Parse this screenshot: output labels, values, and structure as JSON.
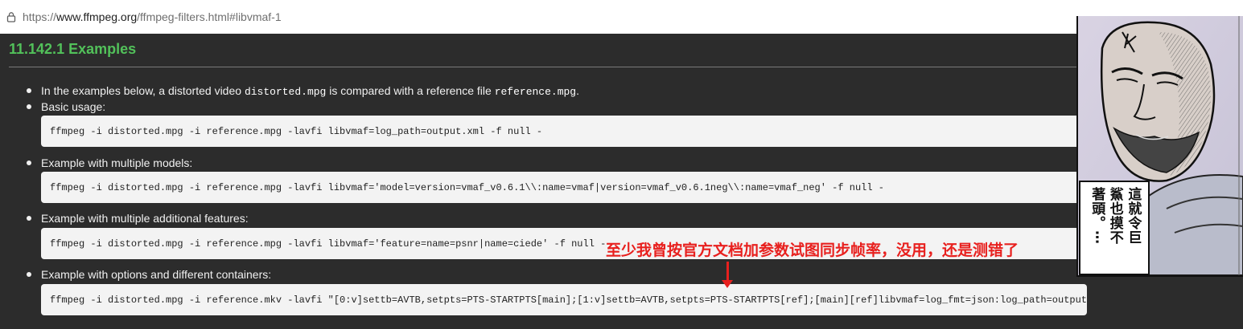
{
  "browser": {
    "url_prefix": "https://",
    "url_domain": "www.ffmpeg.org",
    "url_path": "/ffmpeg-filters.html#libvmaf-1"
  },
  "section": {
    "title": "11.142.1 Examples"
  },
  "items": [
    {
      "intro_pre": "In the examples below, a distorted video ",
      "code_a": "distorted.mpg",
      "intro_mid": " is compared with a reference file ",
      "code_b": "reference.mpg",
      "intro_post": "."
    },
    {
      "label": "Basic usage:",
      "code": "ffmpeg -i distorted.mpg -i reference.mpg -lavfi libvmaf=log_path=output.xml -f null -"
    },
    {
      "label": "Example with multiple models:",
      "code": "ffmpeg -i distorted.mpg -i reference.mpg -lavfi libvmaf='model=version=vmaf_v0.6.1\\\\:name=vmaf|version=vmaf_v0.6.1neg\\\\:name=vmaf_neg' -f null -"
    },
    {
      "label": "Example with multiple additional features:",
      "code": "ffmpeg -i distorted.mpg -i reference.mpg -lavfi libvmaf='feature=name=psnr|name=ciede' -f null -"
    },
    {
      "label": "Example with options and different containers:",
      "code": "ffmpeg -i distorted.mpg -i reference.mkv -lavfi \"[0:v]settb=AVTB,setpts=PTS-STARTPTS[main];[1:v]settb=AVTB,setpts=PTS-STARTPTS[ref];[main][ref]libvmaf=log_fmt=json:log_path=output.json\" -f null -"
    }
  ],
  "annotation": {
    "text": "至少我曾按官方文档加参数试图同步帧率，没用，还是测错了",
    "color": "#e8201e"
  },
  "manga": {
    "caption_col_1": "這就令巨",
    "caption_col_2": "鯊也摸不",
    "caption_col_3": "著頭。⋯"
  },
  "colors": {
    "heading": "#52c15a",
    "page_bg": "#2c2c2c",
    "code_bg": "#f3f3f3"
  }
}
